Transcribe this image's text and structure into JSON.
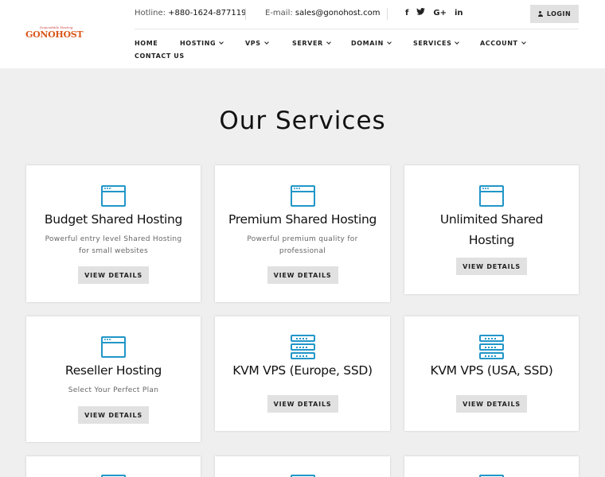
{
  "brand": {
    "tagline": "Dependable Hosting",
    "name": "GONOHOST"
  },
  "topbar": {
    "hotline_label": "Hotline:",
    "hotline_value": "+880-1624-877119",
    "email_label": "E-mail:",
    "email_value": "sales@gonohost.com",
    "social": [
      {
        "icon": "facebook-icon",
        "glyph": "f"
      },
      {
        "icon": "twitter-icon",
        "glyph": "🐦"
      },
      {
        "icon": "google-plus-icon",
        "glyph": "G+"
      },
      {
        "icon": "linkedin-icon",
        "glyph": "in"
      }
    ],
    "login_label": "LOGIN"
  },
  "nav": {
    "items": [
      {
        "label": "HOME",
        "has_dropdown": false
      },
      {
        "label": "HOSTING",
        "has_dropdown": true
      },
      {
        "label": "VPS",
        "has_dropdown": true
      },
      {
        "label": "SERVER",
        "has_dropdown": true
      },
      {
        "label": "DOMAIN",
        "has_dropdown": true
      },
      {
        "label": "SERVICES",
        "has_dropdown": true
      },
      {
        "label": "ACCOUNT",
        "has_dropdown": true
      },
      {
        "label": "CONTACT US",
        "has_dropdown": false
      }
    ]
  },
  "main": {
    "title": "Our Services",
    "cards": [
      {
        "icon": "browser-window-icon",
        "title": "Budget Shared Hosting",
        "desc": "Powerful entry level Shared Hosting for small websites",
        "button": "VIEW DETAILS"
      },
      {
        "icon": "browser-window-icon",
        "title": "Premium Shared Hosting",
        "desc": "Powerful premium quality for professional",
        "button": "VIEW DETAILS"
      },
      {
        "icon": "browser-window-icon",
        "title": "Unlimited Shared Hosting",
        "desc": "",
        "button": "VIEW DETAILS"
      },
      {
        "icon": "browser-window-icon",
        "title": "Reseller Hosting",
        "desc": "Select Your Perfect Plan",
        "button": "VIEW DETAILS"
      },
      {
        "icon": "server-stack-icon",
        "title": "KVM VPS (Europe, SSD)",
        "desc": "",
        "button": "VIEW DETAILS"
      },
      {
        "icon": "server-stack-icon",
        "title": "KVM VPS (USA, SSD)",
        "desc": "",
        "button": "VIEW DETAILS"
      }
    ]
  },
  "colors": {
    "accent": "#2196c8",
    "logo": "#d9581c",
    "page_bg": "#efefef",
    "button_bg": "#e1e1e1"
  }
}
